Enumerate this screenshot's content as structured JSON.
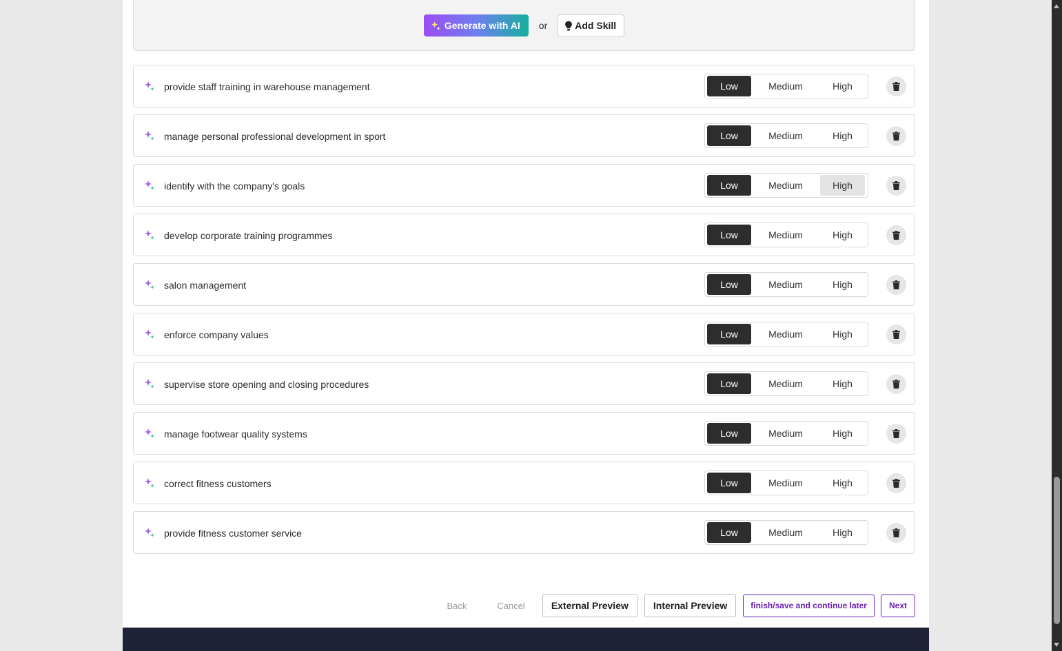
{
  "ai_panel": {
    "generate_label": "Generate with AI",
    "or_text": "or",
    "add_skill_label": "Add Skill"
  },
  "level_labels": {
    "low": "Low",
    "medium": "Medium",
    "high": "High"
  },
  "skills": [
    {
      "label": "provide staff training in warehouse management",
      "level": "Low"
    },
    {
      "label": "manage personal professional development in sport",
      "level": "Low"
    },
    {
      "label": "identify with the company's goals",
      "level": "Low",
      "hovered": "High"
    },
    {
      "label": "develop corporate training programmes",
      "level": "Low"
    },
    {
      "label": "salon management",
      "level": "Low"
    },
    {
      "label": "enforce company values",
      "level": "Low"
    },
    {
      "label": "supervise store opening and closing procedures",
      "level": "Low"
    },
    {
      "label": "manage footwear quality systems",
      "level": "Low"
    },
    {
      "label": "correct fitness customers",
      "level": "Low"
    },
    {
      "label": "provide fitness customer service",
      "level": "Low"
    }
  ],
  "actions": {
    "back": "Back",
    "cancel": "Cancel",
    "external_preview": "External Preview",
    "internal_preview": "Internal Preview",
    "finish_save": "finish/save and continue later",
    "next": "Next"
  },
  "icons": {
    "sparkle": "sparkle-icon",
    "lightbulb": "lightbulb-icon",
    "trash": "trash-icon"
  },
  "colors": {
    "ai_gradient_start": "#9a4df2",
    "ai_gradient_end": "#16b09e",
    "active_level": "#2d2d2d",
    "brand_purple": "#6a1fb3",
    "footer_bg": "#1d2237"
  }
}
